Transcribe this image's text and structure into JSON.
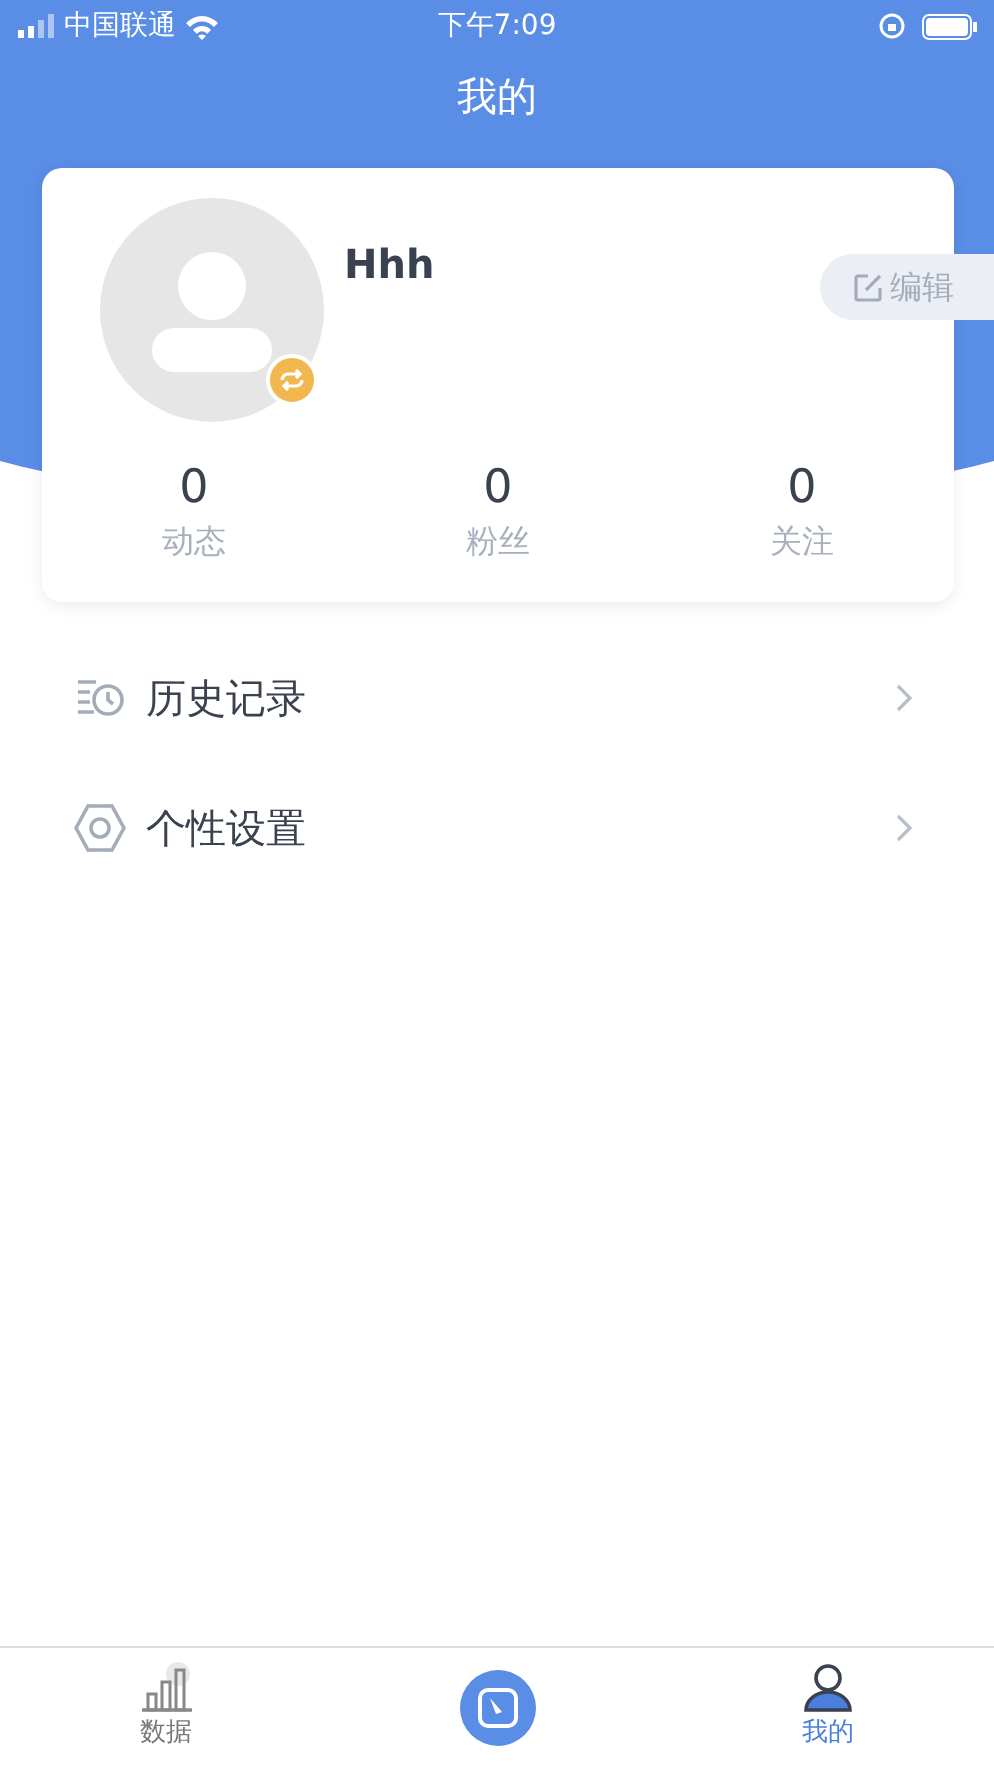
{
  "status_bar": {
    "carrier": "中国联通",
    "time": "下午7:09"
  },
  "header": {
    "title": "我的"
  },
  "profile": {
    "name": "Hhh",
    "edit_button": "编辑",
    "stats": [
      {
        "value": "0",
        "label": "动态"
      },
      {
        "value": "0",
        "label": "粉丝"
      },
      {
        "value": "0",
        "label": "关注"
      }
    ]
  },
  "menu": [
    {
      "kind": "history",
      "label": "历史记录"
    },
    {
      "kind": "settings",
      "label": "个性设置"
    }
  ],
  "tab_bar": [
    {
      "kind": "chart",
      "label": "数据",
      "selected": false
    },
    {
      "kind": "center",
      "selected": false
    },
    {
      "kind": "person",
      "label": "我的",
      "selected": true
    }
  ]
}
